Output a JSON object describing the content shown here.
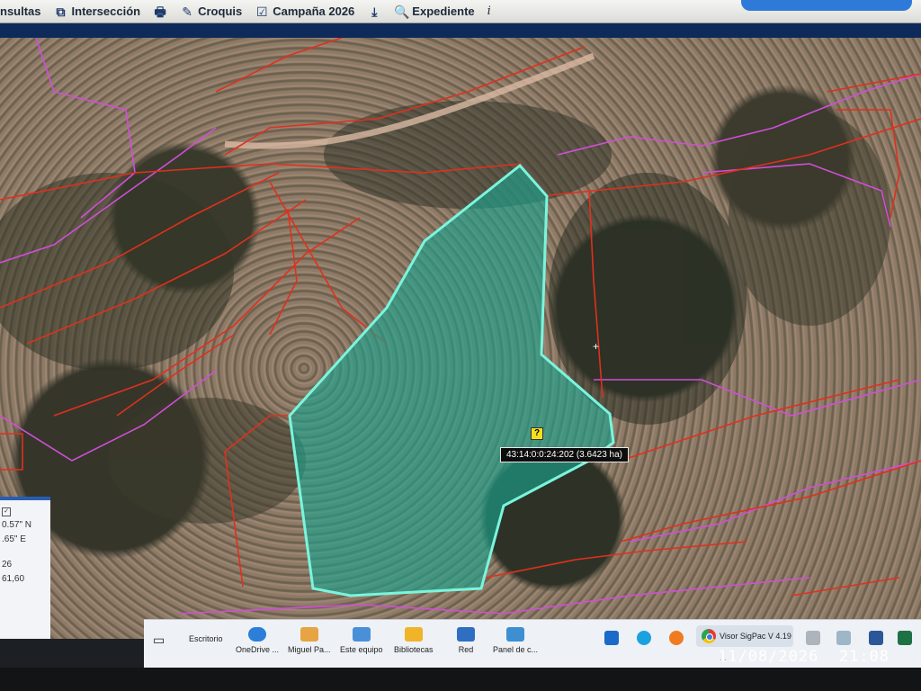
{
  "toolbar": {
    "consultas": "nsultas",
    "interseccion": "Intersección",
    "croquis": "Croquis",
    "campana": "Campaña 2026",
    "expediente": "Expediente",
    "info": "i"
  },
  "map": {
    "tooltip": "43:14:0:0:24:202 (3.6423 ha)",
    "help_cursor": "?",
    "parcel_fill_color": "#1aa58f",
    "parcel_stroke_color": "#7af5de",
    "boundary_red": "#e0301e",
    "boundary_magenta": "#d04fd8"
  },
  "coords_panel": {
    "rows": [
      "0.57\" N",
      ".65\" E",
      "26",
      "61,60"
    ]
  },
  "taskbar": {
    "items": [
      {
        "label": "Escritorio"
      },
      {
        "label": "OneDrive ..."
      },
      {
        "label": "Miguel Pa..."
      },
      {
        "label": "Este equipo"
      },
      {
        "label": "Bibliotecas"
      },
      {
        "label": "Red"
      },
      {
        "label": "Panel de c..."
      }
    ],
    "active_app": "Visor SigPac V 4.19 ..."
  },
  "clock": {
    "date": "11/08/2026",
    "time": "21:08"
  }
}
